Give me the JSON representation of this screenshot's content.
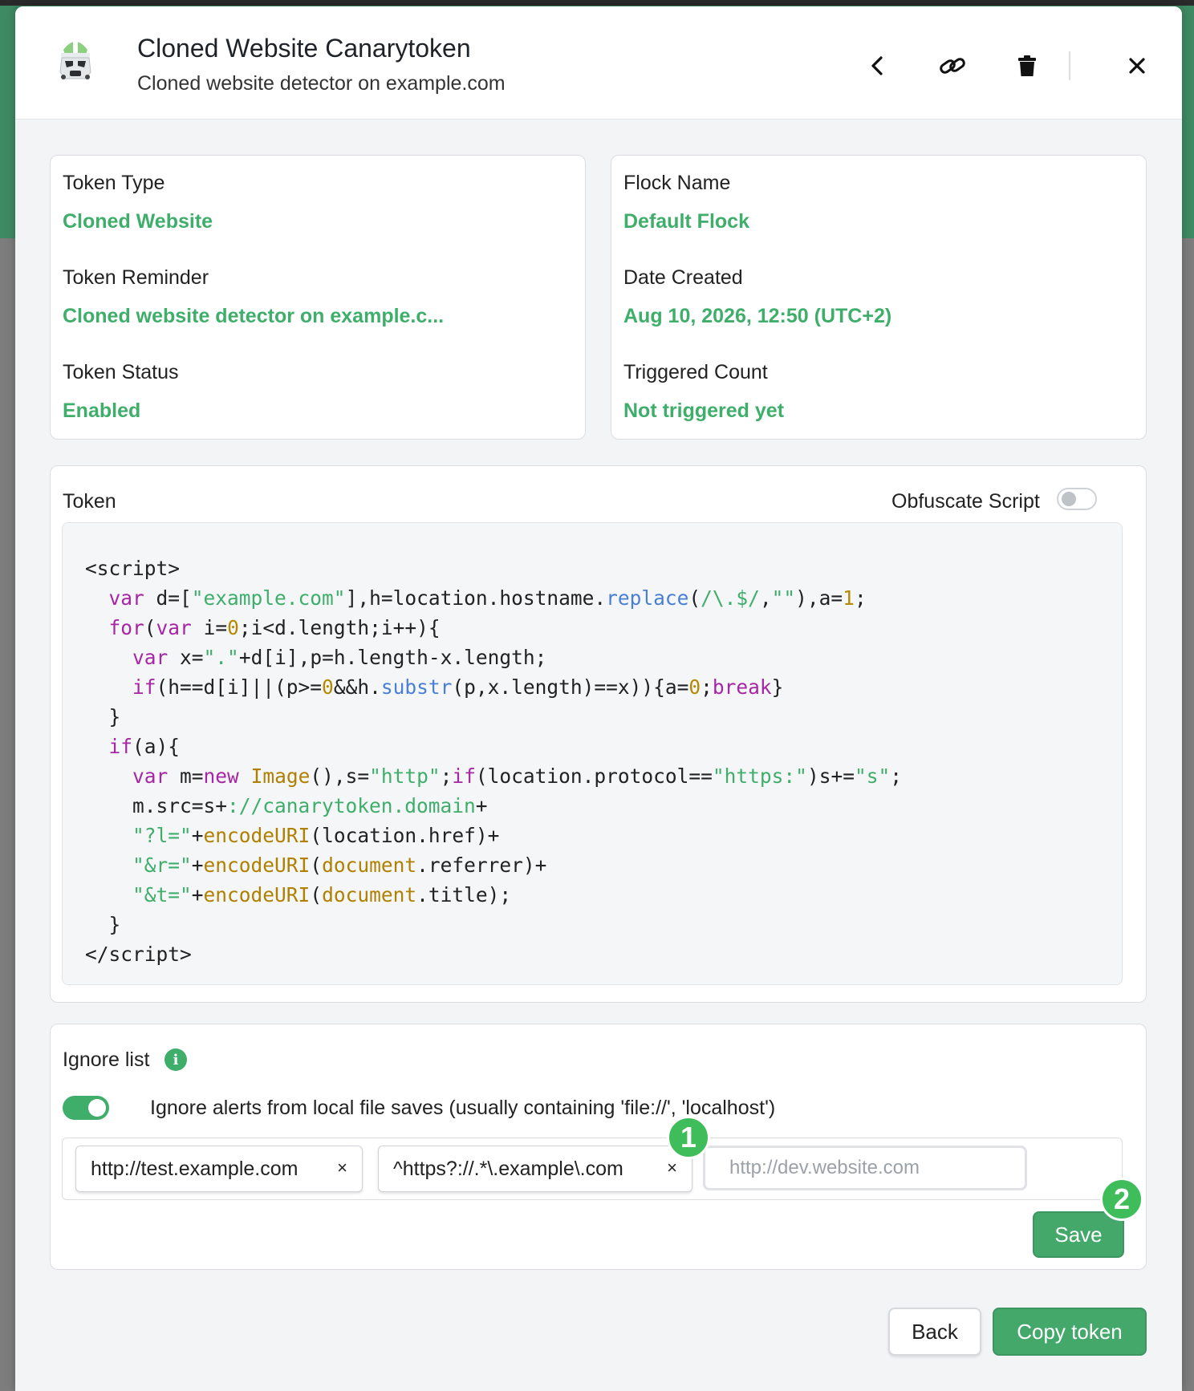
{
  "header": {
    "title": "Cloned Website Canarytoken",
    "subtitle": "Cloned website detector on example.com"
  },
  "details": {
    "token_type_label": "Token Type",
    "token_type_value": "Cloned Website",
    "token_reminder_label": "Token Reminder",
    "token_reminder_value": "Cloned website detector on example.c...",
    "token_status_label": "Token Status",
    "token_status_value": "Enabled",
    "flock_name_label": "Flock Name",
    "flock_name_value": "Default Flock",
    "date_created_label": "Date Created",
    "date_created_value": "Aug 10, 2026, 12:50 (UTC+2)",
    "triggered_count_label": "Triggered Count",
    "triggered_count_value": "Not triggered yet"
  },
  "token": {
    "label": "Token",
    "obfuscate_label": "Obfuscate Script",
    "obfuscate_enabled": false
  },
  "ignore_list": {
    "title": "Ignore list",
    "local_files_toggle_label": "Ignore alerts from local file saves (usually containing 'file://', 'localhost')",
    "local_files_enabled": true,
    "entries": [
      "http://test.example.com",
      "^https?://.*\\.example\\.com"
    ],
    "remove_symbol": "×",
    "input_placeholder": "http://dev.website.com",
    "save_label": "Save"
  },
  "annotations": {
    "badge1": "1",
    "badge2": "2"
  },
  "footer": {
    "back_label": "Back",
    "copy_label": "Copy token"
  },
  "colors": {
    "accent": "#3fae6b",
    "badge": "#3fbd5b",
    "keyword": "#a626a4",
    "function": "#4a7fd6",
    "number": "#b58a00"
  }
}
